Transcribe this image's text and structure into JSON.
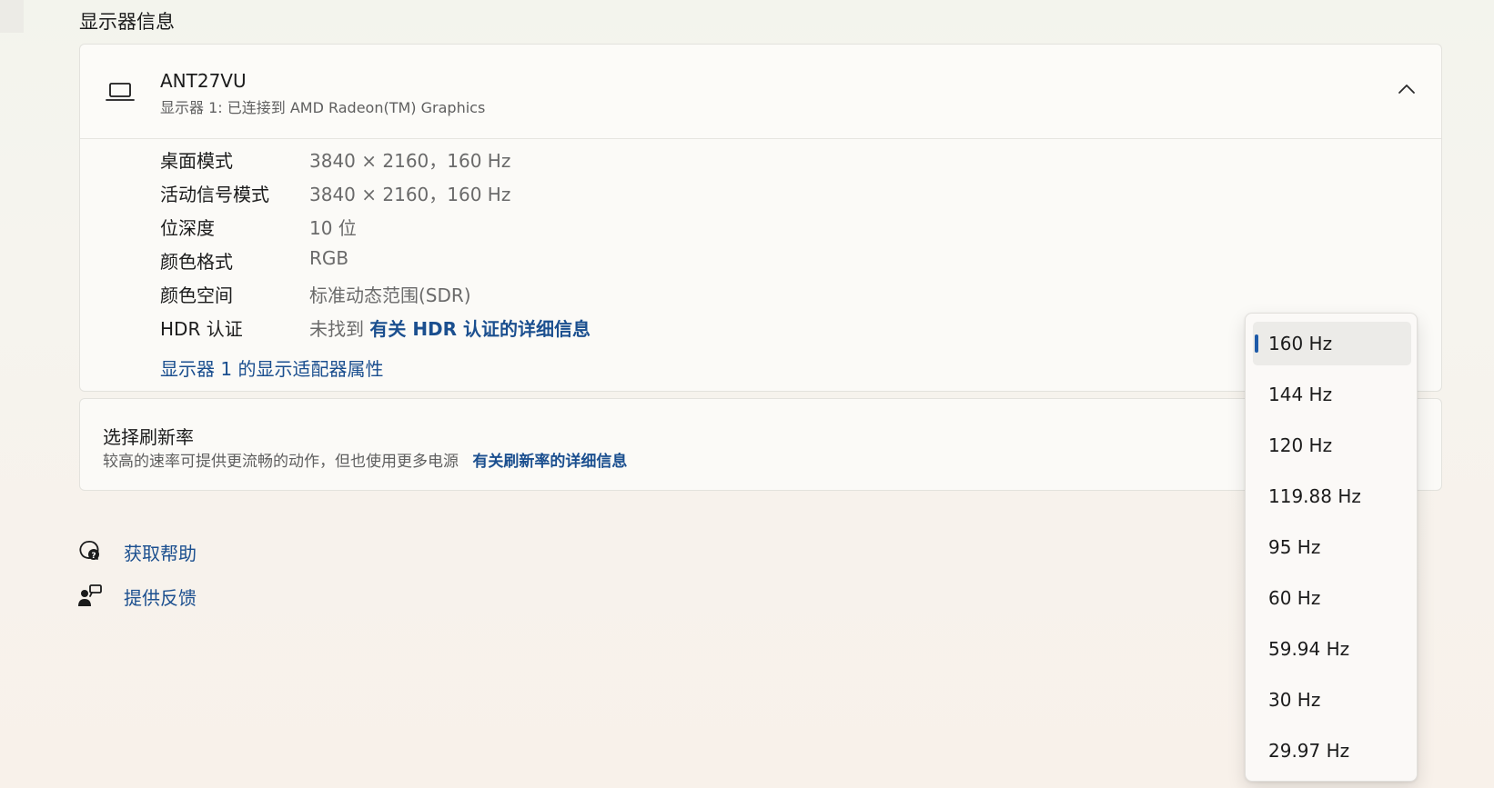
{
  "section_title": "显示器信息",
  "monitor": {
    "name": "ANT27VU",
    "subtitle": "显示器 1: 已连接到 AMD Radeon(TM) Graphics",
    "icon": "laptop-icon",
    "expanded": true
  },
  "info": [
    {
      "label": "桌面模式",
      "value": "3840 × 2160，160 Hz"
    },
    {
      "label": "活动信号模式",
      "value": "3840 × 2160，160 Hz"
    },
    {
      "label": "位深度",
      "value": "10 位"
    },
    {
      "label": "颜色格式",
      "value": "RGB"
    },
    {
      "label": "颜色空间",
      "value": "标准动态范围(SDR)"
    },
    {
      "label": "HDR 认证",
      "value": "未找到",
      "link": "有关 HDR 认证的详细信息"
    }
  ],
  "adapter_link": "显示器 1 的显示适配器属性",
  "refresh": {
    "title": "选择刷新率",
    "description": "较高的速率可提供更流畅的动作，但也使用更多电源",
    "link": "有关刷新率的详细信息"
  },
  "help_links": {
    "get_help": "获取帮助",
    "feedback": "提供反馈"
  },
  "dropdown": {
    "selected": "160 Hz",
    "options": [
      "160 Hz",
      "144 Hz",
      "120 Hz",
      "119.88 Hz",
      "95 Hz",
      "60 Hz",
      "59.94 Hz",
      "30 Hz",
      "29.97 Hz"
    ]
  },
  "colors": {
    "accent": "#1e5aa8",
    "link": "#1b4f8f"
  }
}
